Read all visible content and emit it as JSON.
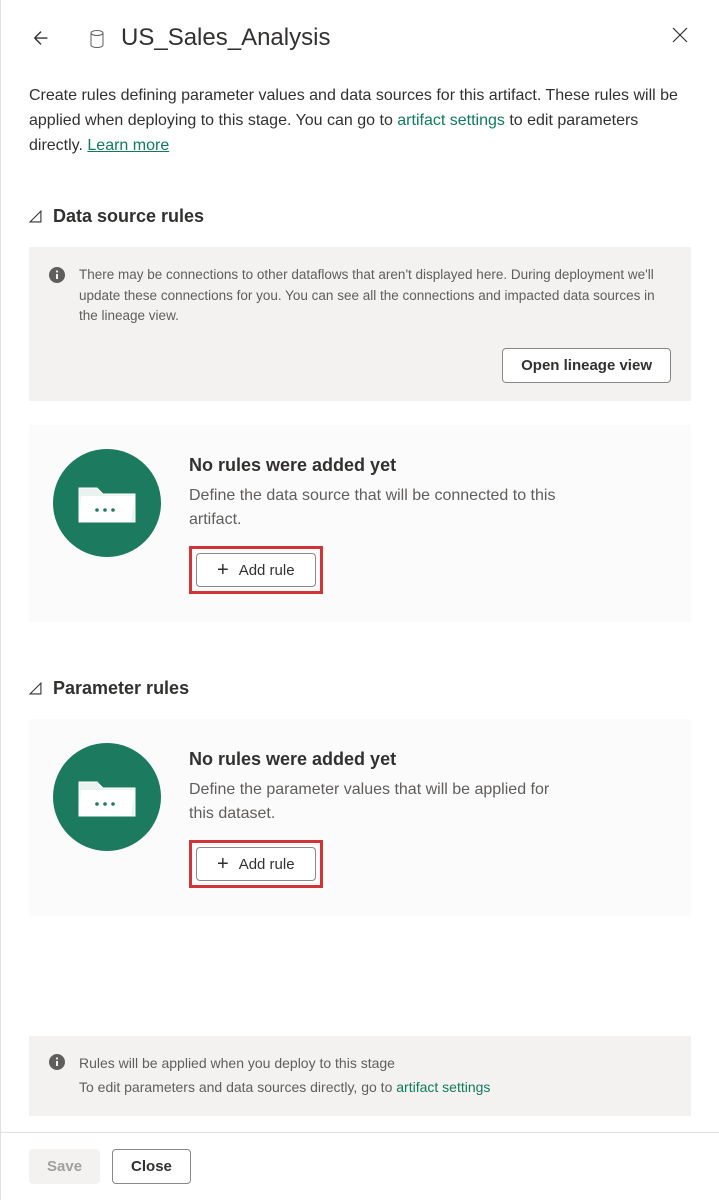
{
  "header": {
    "title": "US_Sales_Analysis"
  },
  "description": {
    "text_before": "Create rules defining parameter values and data sources for this artifact. These rules will be applied when deploying to this stage. You can go to ",
    "artifact_link": "artifact settings",
    "text_after": " to edit parameters directly. ",
    "learn_more": "Learn more"
  },
  "data_source_section": {
    "title": "Data source rules",
    "info_text": "There may be connections to other dataflows that aren't displayed here. During deployment we'll update these connections for you. You can see all the connections and impacted data sources in the lineage view.",
    "lineage_button": "Open lineage view",
    "empty_title": "No rules were added yet",
    "empty_desc": "Define the data source that will be connected to this artifact.",
    "add_rule": "Add rule"
  },
  "parameter_section": {
    "title": "Parameter rules",
    "empty_title": "No rules were added yet",
    "empty_desc": "Define the parameter values that will be applied for this dataset.",
    "add_rule": "Add rule"
  },
  "footer_info": {
    "line1": "Rules will be applied when you deploy to this stage",
    "line2_before": "To edit parameters and data sources directly, go to ",
    "line2_link": "artifact settings"
  },
  "bottom_bar": {
    "save": "Save",
    "close": "Close"
  }
}
